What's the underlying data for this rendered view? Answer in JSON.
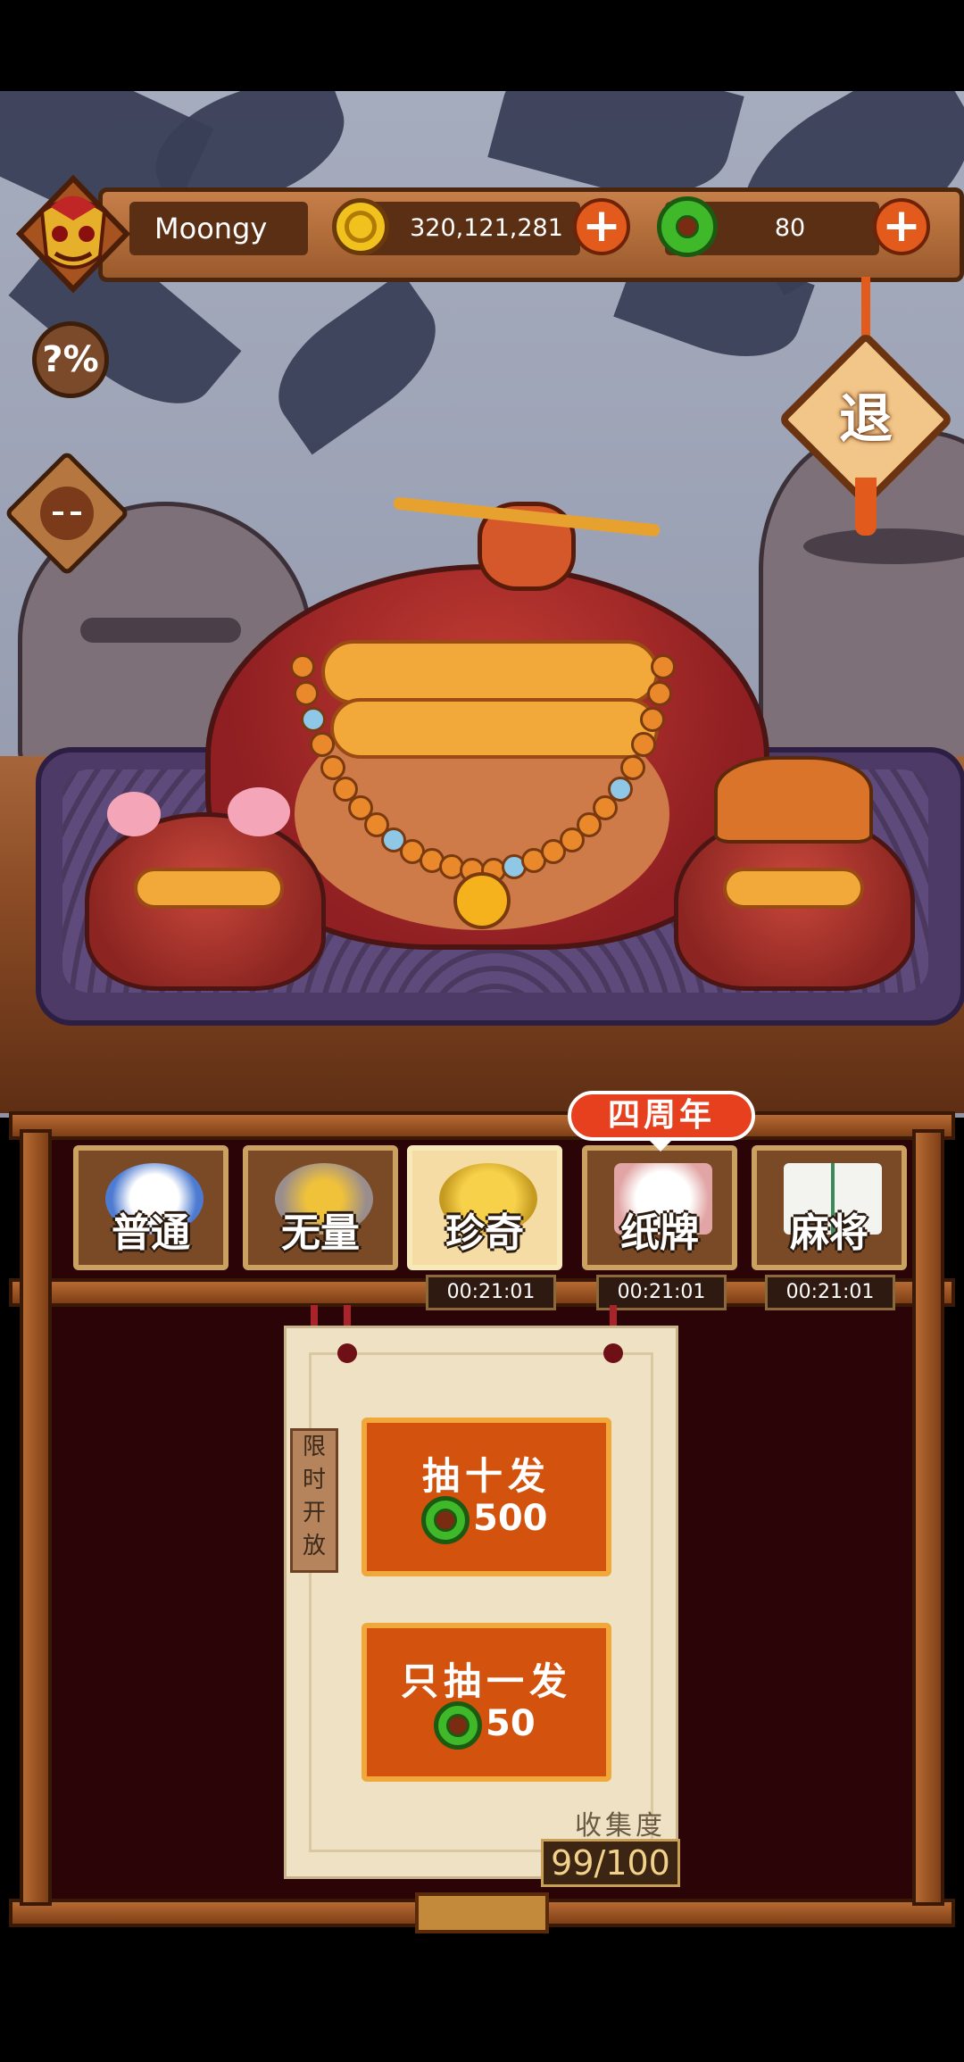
{
  "player": {
    "name": "Moongy"
  },
  "currency": {
    "coins": "320,121,281",
    "jade": "80"
  },
  "buttons": {
    "quit_label": "退",
    "odds_label": "?%"
  },
  "tabs": [
    {
      "label": "普通",
      "timer": ""
    },
    {
      "label": "无量",
      "timer": ""
    },
    {
      "label": "珍奇",
      "timer": "00:21:01"
    },
    {
      "label": "纸牌",
      "timer": "00:21:01"
    },
    {
      "label": "麻将",
      "timer": "00:21:01"
    }
  ],
  "badge": {
    "anniversary": "四周年"
  },
  "gacha": {
    "limited_tag": "限时开放",
    "draw_ten": {
      "label": "抽十发",
      "cost": "500"
    },
    "draw_one": {
      "label": "只抽一发",
      "cost": "50"
    },
    "collection_label": "收集度",
    "collection_value": "99/100"
  }
}
